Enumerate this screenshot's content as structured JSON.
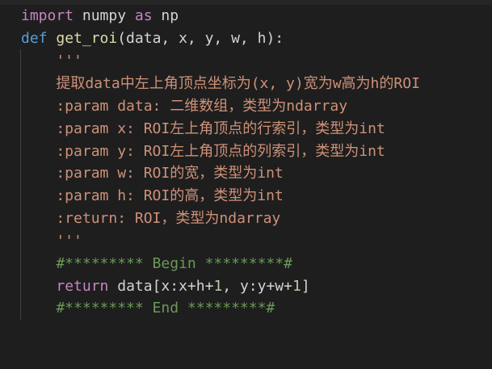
{
  "code": {
    "line1": {
      "kw_import": "import",
      "module": " numpy ",
      "kw_as": "as",
      "alias": " np"
    },
    "line2": {
      "kw_def": "def",
      "fname": " get_roi",
      "params": "(data, x, y, w, h):"
    },
    "line3": {
      "text": "    '''"
    },
    "line4": {
      "text": "    提取data中左上角顶点坐标为(x, y)宽为w高为h的ROI"
    },
    "line5": {
      "text": "    :param data: 二维数组，类型为ndarray"
    },
    "line6": {
      "text": "    :param x: ROI左上角顶点的行索引，类型为int"
    },
    "line7": {
      "text": "    :param y: ROI左上角顶点的列索引，类型为int"
    },
    "line8": {
      "text": "    :param w: ROI的宽，类型为int"
    },
    "line9": {
      "text": "    :param h: ROI的高，类型为int"
    },
    "line10": {
      "text": "    :return: ROI，类型为ndarray"
    },
    "line11": {
      "text": "    '''"
    },
    "line12": {
      "text": "    #********* Begin *********#"
    },
    "line13": {
      "indent": "    ",
      "kw_return": "return",
      "expr_a": " data[x:x+h+",
      "num1": "1",
      "expr_b": ", y:y+w+",
      "num2": "1",
      "expr_c": "]"
    },
    "line14": {
      "text": "    #********* End *********#"
    }
  },
  "colors": {
    "background": "#1e1e1e",
    "keyword": "#569cd6",
    "control": "#c586c0",
    "function": "#dcdcaa",
    "string": "#ce9178",
    "comment": "#6a9955",
    "number": "#b5cea8"
  }
}
